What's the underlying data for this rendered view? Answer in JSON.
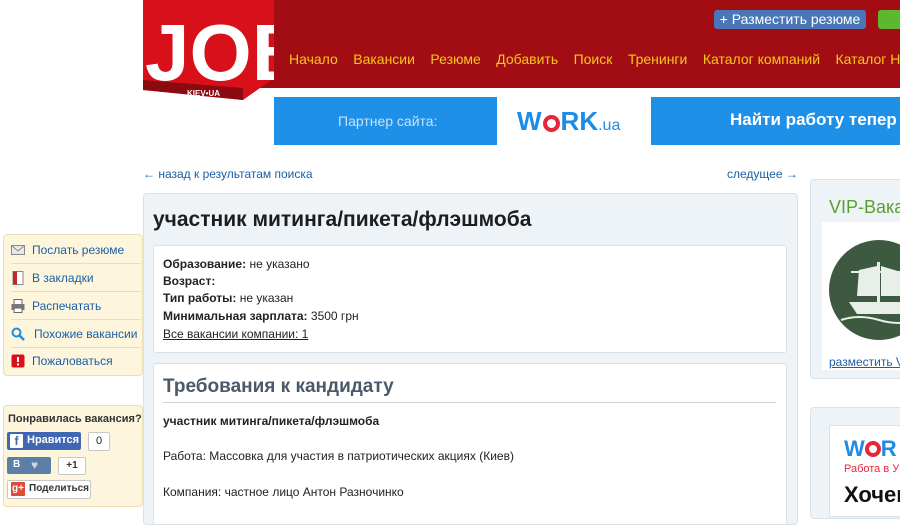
{
  "header": {
    "logo_text": "JOB",
    "logo_sub": "KIEV•UA",
    "post_resume_label": "+ Разместить резюме",
    "nav": [
      "Начало",
      "Вакансии",
      "Резюме",
      "Добавить",
      "Поиск",
      "Тренинги",
      "Каталог компаний",
      "Каталог HR-а"
    ]
  },
  "partner_banner": {
    "label": "Партнер сайта:",
    "logo_main": "W",
    "logo_rest": "RK",
    "logo_ua": ".ua",
    "slogan": "Найти работу тепер"
  },
  "navigation": {
    "back": "← назад к результатам поиска",
    "next": "следущее →"
  },
  "job": {
    "title": "участник митинга/пикета/флэшмоба",
    "info": [
      {
        "label": "Образование:",
        "value": "не указано"
      },
      {
        "label": "Возраст:",
        "value": ""
      },
      {
        "label": "Тип работы:",
        "value": "не указан"
      },
      {
        "label": "Минимальная зарплата:",
        "value": "3500 грн"
      }
    ],
    "company_link": "Все вакансии компании: 1",
    "requirements_heading": "Требования к кандидату",
    "requirements": [
      "участник митинга/пикета/флэшмоба",
      "Работа: Массовка для участия в патриотических акциях (Киев)",
      "Компания: частное лицо Антон Разночинко"
    ]
  },
  "actions": [
    {
      "label": "Послать резюме",
      "icon": "mail-icon"
    },
    {
      "label": "В закладки",
      "icon": "bookmark-icon"
    },
    {
      "label": "Распечатать",
      "icon": "printer-icon"
    },
    {
      "label": "Похожие вакансии",
      "icon": "search-icon"
    },
    {
      "label": "Пожаловаться",
      "icon": "warning-icon"
    }
  ],
  "share": {
    "title": "Понравилась вакансия?",
    "facebook_label": "Нравится",
    "facebook_count": "0",
    "vk_label": "В",
    "vk_count": "+1",
    "gplus_label": "Поделиться"
  },
  "right": {
    "vip_title": "VIP-Вака",
    "vip_link": "разместить V",
    "work_logo_w": "W",
    "work_logo_rest": "R",
    "work_sub": "Работа в У",
    "work_big": "Хочеш"
  },
  "colors": {
    "header_red": "#a10d12",
    "nav_yellow": "#f7c71b",
    "link_blue": "#1a5ea8",
    "banner_blue": "#1e90e8",
    "vip_green": "#5aa02c"
  }
}
